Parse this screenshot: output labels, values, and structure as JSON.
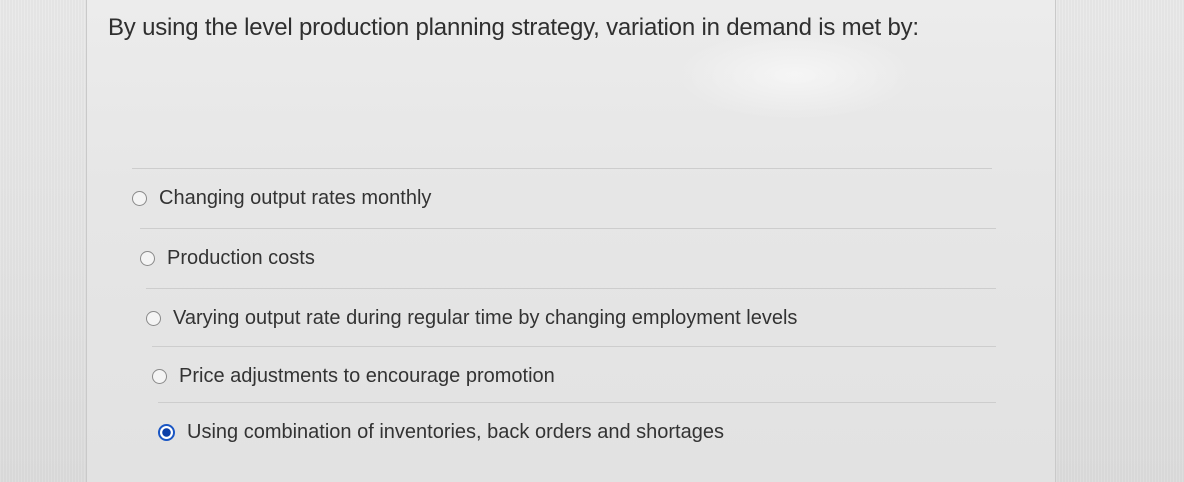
{
  "question": {
    "text": "By using the level production planning strategy, variation in demand is met by:"
  },
  "answers": [
    {
      "label": "Changing output rates monthly",
      "selected": false
    },
    {
      "label": "Production costs",
      "selected": false
    },
    {
      "label": "Varying output rate during regular time by changing employment levels",
      "selected": false
    },
    {
      "label": "Price adjustments to encourage promotion",
      "selected": false
    },
    {
      "label": "Using combination of inventories, back orders and shortages",
      "selected": true
    }
  ],
  "colors": {
    "selected_radio": "#0c3fa8",
    "background": "#e6e6e6",
    "text": "#333333"
  }
}
